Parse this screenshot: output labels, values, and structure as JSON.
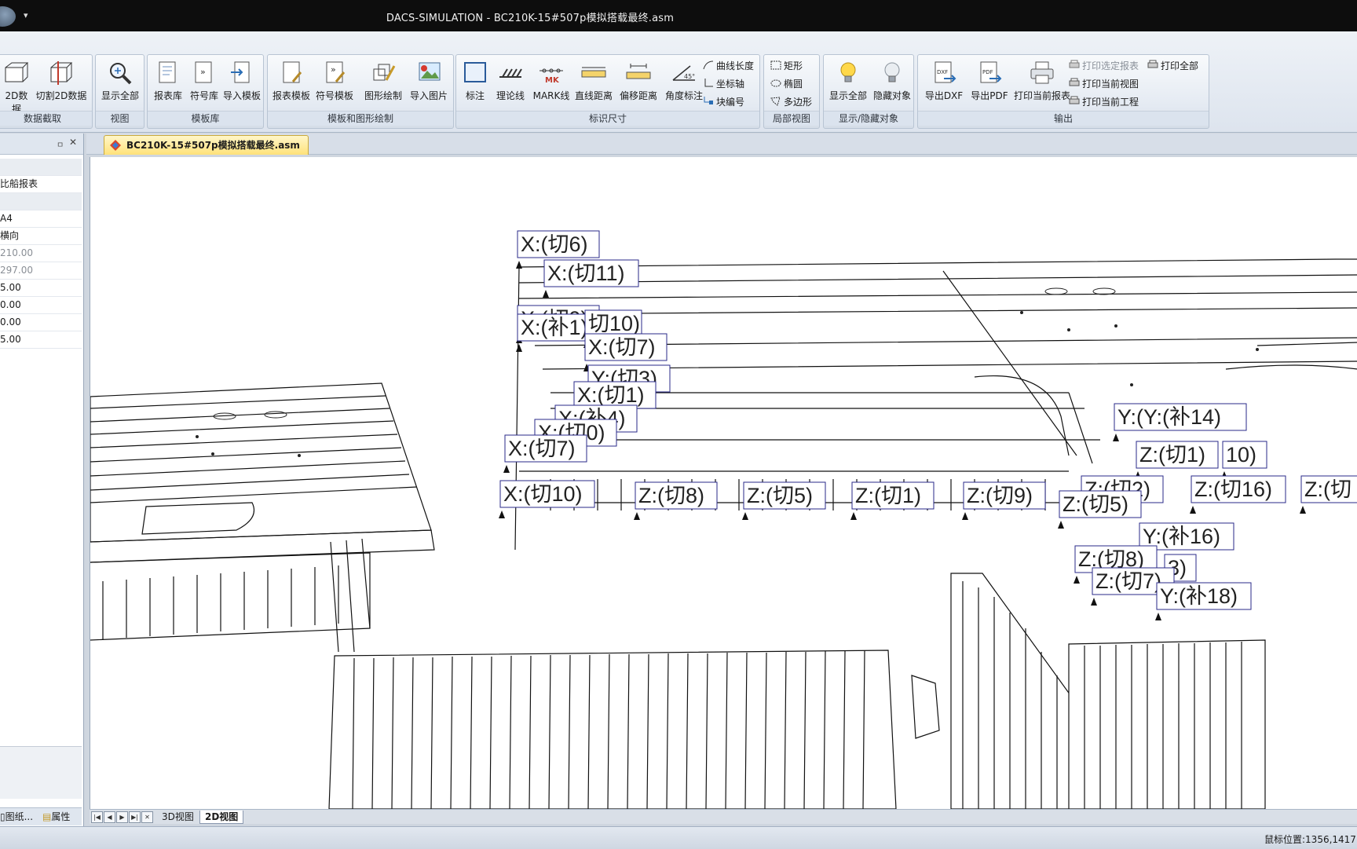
{
  "window": {
    "title": "DACS-SIMULATION - BC210K-15#507p模拟搭载最终.asm"
  },
  "ribbon": {
    "groups": [
      {
        "label": "数据截取",
        "buttons": [
          "2D数据",
          "切割2D数据"
        ]
      },
      {
        "label": "视图",
        "buttons": [
          "显示全部"
        ]
      },
      {
        "label": "模板库",
        "buttons": [
          "报表库",
          "符号库",
          "导入模板"
        ]
      },
      {
        "label": "模板和图形绘制",
        "buttons": [
          "报表模板",
          "符号模板",
          "图形绘制",
          "导入图片"
        ]
      },
      {
        "label": "标识尺寸",
        "buttons": [
          "标注",
          "理论线",
          "MARK线",
          "直线距离",
          "偏移距离",
          "角度标注"
        ],
        "small": [
          "曲线长度",
          "坐标轴",
          "块编号"
        ]
      },
      {
        "label": "局部视图",
        "small": [
          "矩形",
          "椭圆",
          "多边形"
        ]
      },
      {
        "label": "显示/隐藏对象",
        "buttons": [
          "显示全部",
          "隐藏对象"
        ]
      },
      {
        "label": "输出",
        "buttons": [
          "导出DXF",
          "导出PDF",
          "打印当前报表"
        ],
        "small": [
          "打印选定报表",
          "打印当前视图",
          "打印当前工程",
          "打印全部"
        ]
      }
    ]
  },
  "icons": {
    "mk_text": "MK",
    "dxf_text": "DXF",
    "pdf_text": "PDF",
    "angle_text": "45°"
  },
  "panel": {
    "pin": "ㅁ",
    "close": "✕",
    "rows": [
      "",
      "比船报表",
      "",
      "A4",
      "横向",
      "210.00",
      "297.00",
      "5.00",
      "0.00",
      "0.00",
      "5.00"
    ],
    "tabs": [
      "图纸...",
      "属性"
    ]
  },
  "document": {
    "tab": "BC210K-15#507p模拟搭载最终.asm"
  },
  "canvas": {
    "labels": [
      "X:(切6)",
      "X:(切11)",
      "X:(切9)",
      "X:(补1)",
      "切10)",
      "X:(切7)",
      "Y:(切3)",
      "X:(切1)",
      "X:(补4)",
      "X:(切0)",
      "X:(切7)",
      "X:(切10)",
      "Z:(切8)",
      "Z:(切5)",
      "Z:(切1)",
      "Z:(切9)",
      "Y:(Y:(补14)",
      "Z:(切1)",
      "10)",
      "Z:(切2)",
      "Z:(切16)",
      "Z:(切",
      "Z:(切5)",
      "Y:(补16)",
      "Z:(切8)",
      "3)",
      "Z:(切7)",
      "Y:(补18)"
    ]
  },
  "view_tabs": [
    "3D视图",
    "2D视图"
  ],
  "status": {
    "mouse_position": "鼠标位置:1356,1417"
  }
}
